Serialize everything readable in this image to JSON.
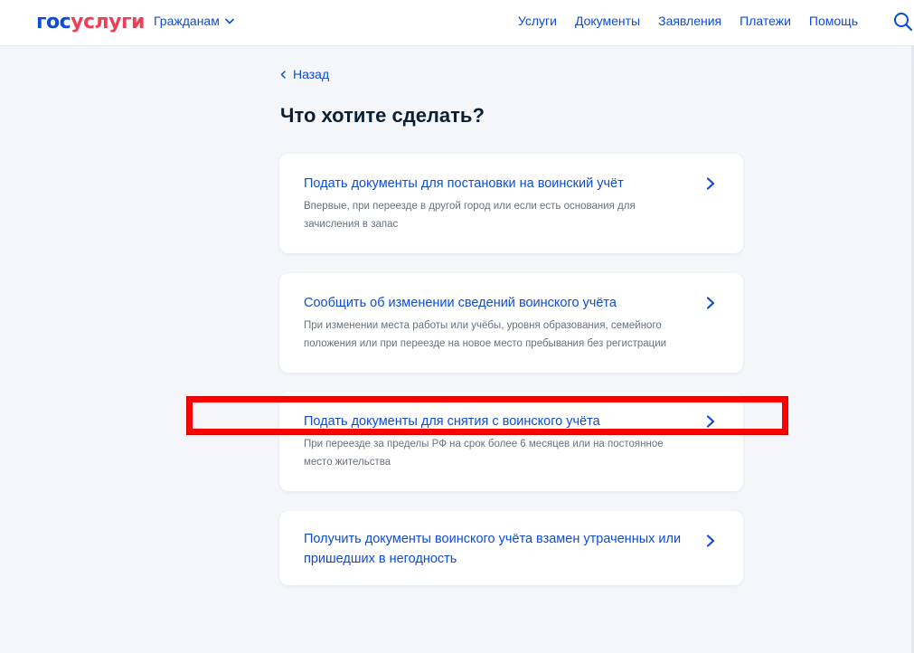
{
  "header": {
    "logo_gos": "гос",
    "logo_uslugi": "услуги",
    "audience_label": "Гражданам",
    "nav": [
      "Услуги",
      "Документы",
      "Заявления",
      "Платежи",
      "Помощь"
    ]
  },
  "back_label": "Назад",
  "page_title": "Что хотите сделать?",
  "cards": [
    {
      "title": "Подать документы для постановки на воинский учёт",
      "description": "Впервые, при переезде в другой город или если есть основания для зачисления в запас"
    },
    {
      "title": "Сообщить об изменении сведений воинского учёта",
      "description": "При изменении места работы или учёбы, уровня образования, семейного положения или при переезде на новое место пребывания без регистрации"
    },
    {
      "title": "Подать документы для снятия с воинского учёта",
      "description": "При переезде за пределы РФ на срок более 6 месяцев или на постоянное место жительства",
      "highlighted": true
    },
    {
      "title": "Получить документы воинского учёта взамен утраченных или пришедших в негодность",
      "description": ""
    }
  ],
  "colors": {
    "brand_blue": "#0d4cd3",
    "brand_red": "#ee3f58",
    "highlight": "#ff0000",
    "background": "#f4f6f9",
    "card": "#ffffff",
    "text": "#0b1f33",
    "muted": "#66727f"
  },
  "icons": [
    "chevron-down-icon",
    "search-icon",
    "back-chevron-icon",
    "chevron-right-icon"
  ]
}
